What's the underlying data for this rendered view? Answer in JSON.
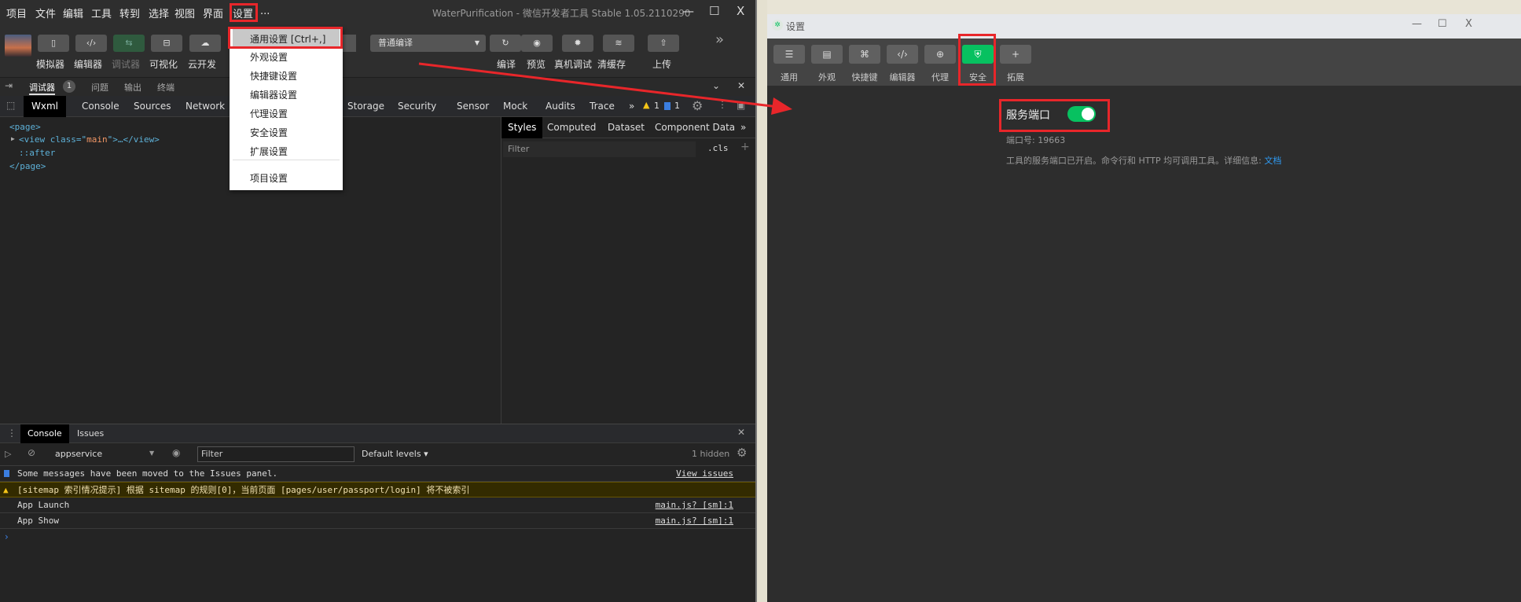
{
  "main_window": {
    "menu": [
      "项目",
      "文件",
      "编辑",
      "工具",
      "转到",
      "选择",
      "视图",
      "界面",
      "设置",
      "..."
    ],
    "title": "WaterPurification - 微信开发者工具 Stable 1.05.2110290",
    "window_controls": [
      "—",
      "☐",
      "X"
    ],
    "toolbar": {
      "left_buttons": [
        {
          "label": "模拟器",
          "icon": "phone-icon"
        },
        {
          "label": "编辑器",
          "icon": "code-icon"
        },
        {
          "label": "调试器",
          "icon": "debug-icon"
        },
        {
          "label": "可视化",
          "icon": "layout-icon"
        },
        {
          "label": "云开发",
          "icon": "cloud-icon"
        }
      ],
      "compile_mode": "普通编译",
      "right_buttons": [
        {
          "label": "编译",
          "icon": "refresh-icon"
        },
        {
          "label": "预览",
          "icon": "eye-icon"
        },
        {
          "label": "真机调试",
          "icon": "bug-icon"
        },
        {
          "label": "清缓存",
          "icon": "layers-icon"
        },
        {
          "label": "上传",
          "icon": "upload-icon"
        }
      ],
      "more": "»"
    },
    "debug_tabs": [
      {
        "label": "调试器",
        "badge": "1"
      },
      {
        "label": "问题"
      },
      {
        "label": "输出"
      },
      {
        "label": "终端"
      }
    ],
    "devtools_tabs": [
      "Wxml",
      "Console",
      "Sources",
      "Network",
      "Storage",
      "Security",
      "Sensor",
      "Mock",
      "Audits",
      "Trace",
      "»"
    ],
    "warning_count": "1",
    "message_count": "1",
    "wxml": {
      "line1": "<page>",
      "line2_pre": "<view class=\"",
      "line2_attr": "main",
      "line2_post": "\">…</view>",
      "line3": "::after",
      "line4": "</page>"
    },
    "style_tabs": [
      "Styles",
      "Computed",
      "Dataset",
      "Component Data",
      "»"
    ],
    "styles_filter_placeholder": "Filter",
    "cls": ".cls",
    "plus": "+",
    "drawer": {
      "tabs": [
        "Console",
        "Issues"
      ],
      "context": "appservice",
      "filter_placeholder": "Filter",
      "levels": "Default levels ▾",
      "hidden": "1 hidden",
      "messages": [
        {
          "type": "info",
          "text": "Some messages have been moved to the Issues panel.",
          "link": "View issues"
        },
        {
          "type": "warning",
          "text": "[sitemap 索引情况提示] 根据 sitemap 的规则[0]，当前页面 [pages/user/passport/login] 将不被索引"
        },
        {
          "type": "log",
          "text": "App Launch",
          "link": "main.js? [sm]:1"
        },
        {
          "type": "log",
          "text": "App Show",
          "link": "main.js? [sm]:1"
        }
      ],
      "prompt": "›"
    },
    "settings_menu": [
      "通用设置  [Ctrl+,]",
      "外观设置",
      "快捷键设置",
      "编辑器设置",
      "代理设置",
      "安全设置",
      "扩展设置",
      "项目设置"
    ]
  },
  "settings_window": {
    "title": "设置",
    "window_controls": [
      "—",
      "☐",
      "X"
    ],
    "tabs": [
      {
        "label": "通用",
        "icon": "sliders-icon"
      },
      {
        "label": "外观",
        "icon": "window-icon"
      },
      {
        "label": "快捷键",
        "icon": "command-icon"
      },
      {
        "label": "编辑器",
        "icon": "code-icon"
      },
      {
        "label": "代理",
        "icon": "globe-icon"
      },
      {
        "label": "安全",
        "icon": "shield-icon",
        "active": true
      },
      {
        "label": "拓展",
        "icon": "plus-icon"
      }
    ],
    "service_port_label": "服务端口",
    "service_port_enabled": true,
    "port_text": "端口号: 19663",
    "description": "工具的服务端口已开启。命令行和 HTTP 均可调用工具。详细信息:",
    "doc_link": "文档",
    "accent": "#07c160"
  }
}
